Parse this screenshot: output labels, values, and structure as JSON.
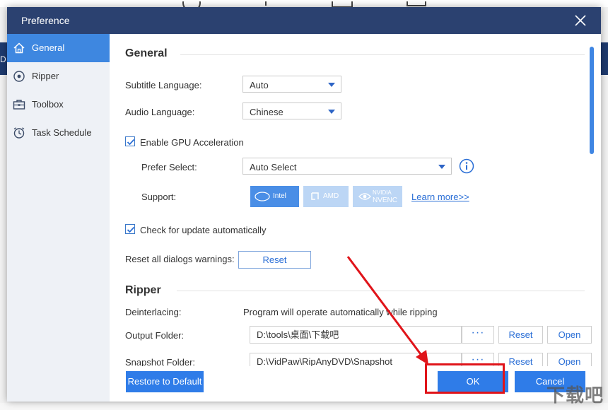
{
  "dialog": {
    "title": "Preference"
  },
  "sidebar": {
    "items": [
      {
        "label": "General",
        "icon": "home-icon",
        "active": true
      },
      {
        "label": "Ripper",
        "icon": "disc-icon",
        "active": false
      },
      {
        "label": "Toolbox",
        "icon": "toolbox-icon",
        "active": false
      },
      {
        "label": "Task Schedule",
        "icon": "clock-icon",
        "active": false
      }
    ]
  },
  "general": {
    "heading": "General",
    "subtitle_language": {
      "label": "Subtitle Language:",
      "value": "Auto"
    },
    "audio_language": {
      "label": "Audio Language:",
      "value": "Chinese"
    },
    "gpu": {
      "label": "Enable GPU Acceleration",
      "checked": true
    },
    "prefer_select": {
      "label": "Prefer Select:",
      "value": "Auto Select"
    },
    "support": {
      "label": "Support:",
      "intel": "Intel",
      "amd": "AMD",
      "nvidia_line1": "NVIDIA",
      "nvidia_line2": "NVENC",
      "learn_more": "Learn more>>"
    },
    "update": {
      "label": "Check for update automatically",
      "checked": true
    },
    "reset_dialogs": {
      "label": "Reset all dialogs warnings:",
      "button": "Reset"
    }
  },
  "ripper": {
    "heading": "Ripper",
    "deinterlacing": {
      "label": "Deinterlacing:",
      "value": "Program will operate automatically while ripping"
    },
    "output_folder": {
      "label": "Output Folder:",
      "path": "D:\\tools\\桌面\\下载吧",
      "dots": "···",
      "reset": "Reset",
      "open": "Open"
    },
    "snapshot_folder": {
      "label": "Snapshot Folder:",
      "path": "D:\\VidPaw\\RipAnyDVD\\Snapshot",
      "dots": "···",
      "reset": "Reset",
      "open": "Open"
    }
  },
  "footer": {
    "restore": "Restore to Default",
    "ok": "OK",
    "cancel": "Cancel"
  },
  "watermark": "下载吧",
  "background": {
    "edge_text": "D"
  },
  "colors": {
    "titlebar": "#2b4170",
    "accent": "#3e87e0",
    "annotation": "#e0141a"
  }
}
